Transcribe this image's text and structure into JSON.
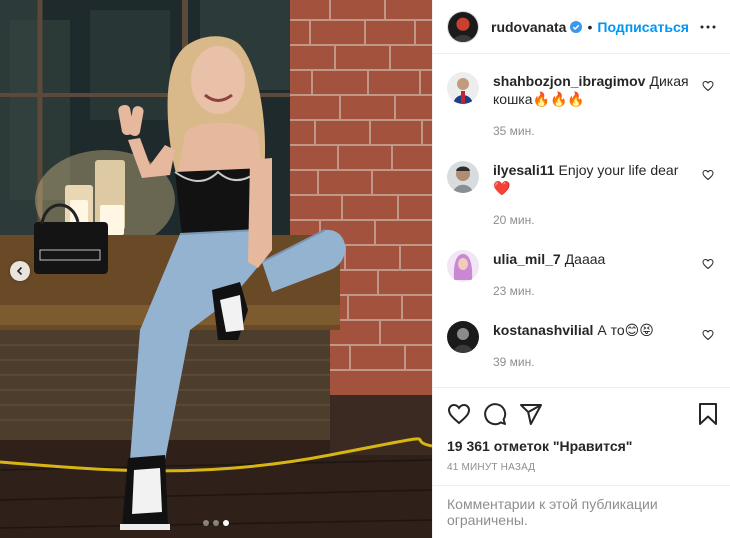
{
  "post": {
    "author": "rudovanata",
    "separator": "•",
    "follow_label": "Подписаться",
    "verified": true,
    "carousel": {
      "slides": 3,
      "active_index": 2
    }
  },
  "comments": [
    {
      "user": "shahbozjon_ibragimov",
      "text": "Дикая кошка🔥🔥🔥",
      "time": "35 мин.",
      "avatar_color": "#1d3f8a"
    },
    {
      "user": "ilyesali11",
      "text": "Enjoy your life dear ❤️",
      "time": "20 мин.",
      "avatar_color": "#8a8f94"
    },
    {
      "user": "ulia_mil_7",
      "text": "Даааа",
      "time": "23 мин.",
      "avatar_color": "#c987d6"
    },
    {
      "user": "kostanashvilial",
      "text": "А то😊😝",
      "time": "39 мин.",
      "avatar_color": "#2b2b2b"
    }
  ],
  "likes_label": "19 361 отметок \"Нравится\"",
  "posted_ago": "41 минут назад",
  "comments_restricted": "Комментарии к этой публикации ограничены.",
  "icons": {
    "like": "heart-icon",
    "comment": "comment-icon",
    "share": "share-icon",
    "save": "bookmark-icon",
    "more": "more-options-icon",
    "prev": "chevron-left-icon"
  },
  "colors": {
    "link": "#0095f6",
    "muted": "#8e8e8e",
    "text": "#262626",
    "border": "#efefef"
  }
}
